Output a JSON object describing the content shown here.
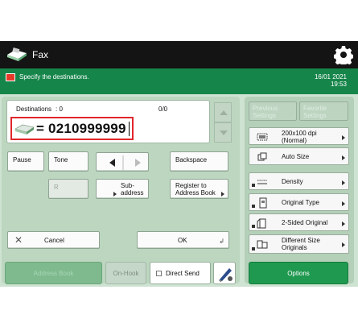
{
  "app": {
    "title": "Fax"
  },
  "status": {
    "message": "Specify the destinations.",
    "date": "16/01 2021",
    "time": "19:53"
  },
  "destination": {
    "label": "Destinations",
    "count": ": 0",
    "page": "0/0",
    "number": "= 0210999999"
  },
  "keys": {
    "pause": "Pause",
    "tone": "Tone",
    "backspace": "Backspace",
    "r": "R",
    "subaddress": "Sub-\naddress",
    "register": "Register to\nAddress Book",
    "cancel": "Cancel",
    "ok": "OK"
  },
  "bottom": {
    "address_book": "Address Book",
    "on_hook": "On-Hook",
    "direct_send": "Direct Send",
    "options": "Options"
  },
  "settings": {
    "previous": "Previous\nSettings",
    "favorite": "Favorite\nSettings",
    "items": [
      {
        "label": "200x100 dpi\n(Normal)",
        "icon": "resolution-icon"
      },
      {
        "label": "Auto Size",
        "icon": "size-icon"
      },
      {
        "label": "Density",
        "icon": "density-icon"
      },
      {
        "label": "Original Type",
        "icon": "original-type-icon"
      },
      {
        "label": "2-Sided Original",
        "icon": "two-sided-icon"
      },
      {
        "label": "Different Size\nOriginals",
        "icon": "different-size-icon"
      }
    ]
  },
  "colors": {
    "accent": "#16854a",
    "error": "#e0262b"
  }
}
